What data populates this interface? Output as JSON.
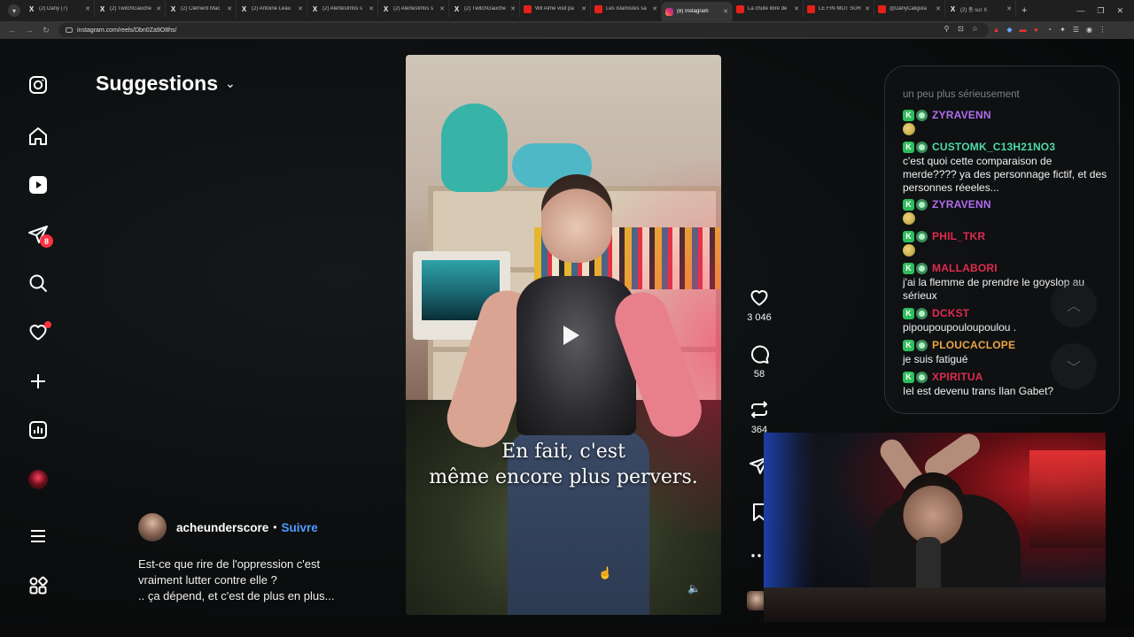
{
  "browser": {
    "tabs": [
      {
        "title": "(2) Dany (7)",
        "icon": "x"
      },
      {
        "title": "(2) TwitchGauche",
        "icon": "x"
      },
      {
        "title": "(2) Clément Mac",
        "icon": "x"
      },
      {
        "title": "(2) Antoine Léau",
        "icon": "x"
      },
      {
        "title": "(2) AlertesInfos s",
        "icon": "x"
      },
      {
        "title": "(2) AlertesInfos s",
        "icon": "x"
      },
      {
        "title": "(2) TwitchGauche",
        "icon": "x"
      },
      {
        "title": "Wil Aime visit pa",
        "icon": "youtube"
      },
      {
        "title": "Les islamistes sa",
        "icon": "youtube"
      },
      {
        "title": "(8) Instagram",
        "icon": "instagram",
        "active": true
      },
      {
        "title": "La chute libre de",
        "icon": "youtube"
      },
      {
        "title": "LE FIN MOT SUR",
        "icon": "youtube"
      },
      {
        "title": "@DanyCaligula",
        "icon": "youtube"
      },
      {
        "title": "(2) 총 sur X",
        "icon": "x"
      }
    ],
    "url": "instagram.com/reels/Dbn0Za9O8hs/"
  },
  "instagram": {
    "heading": "Suggestions",
    "notifications_badge": "8",
    "post": {
      "username": "acheunderscore",
      "separator": "•",
      "follow_label": "Suivre",
      "caption_line1": "Est-ce que rire de l'oppression c'est",
      "caption_line2": "vraiment lutter contre elle ?",
      "caption_line3": ".. ça dépend, et c'est de plus en plus..."
    },
    "video": {
      "subtitle_line1": "En fait, c'est",
      "subtitle_line2": "même encore plus pervers."
    },
    "actions": {
      "likes": "3 046",
      "comments": "58",
      "reposts": "364"
    }
  },
  "chat": {
    "faded_line": "un peu plus sérieusement",
    "messages": [
      {
        "user": "ZYRAVENN",
        "color": "#b26df0",
        "text": "",
        "emote": true
      },
      {
        "user": "CUSTOMK_C13H21NO3",
        "color": "#4fdba8",
        "text": "c'est quoi cette comparaison de merde???? ya des personnage fictif, et des personnes réeeles..."
      },
      {
        "user": "ZYRAVENN",
        "color": "#b26df0",
        "text": "",
        "emote": true
      },
      {
        "user": "PHIL_TKR",
        "color": "#e02b50",
        "text": "",
        "emote": true
      },
      {
        "user": "MALLABORI",
        "color": "#e02b50",
        "text": "j'ai la flemme de prendre le goyslop au sérieux"
      },
      {
        "user": "DCKST",
        "color": "#e02b50",
        "text": "pipoupoupouloupoulou ."
      },
      {
        "user": "PLOUCACLOPE",
        "color": "#e9a545",
        "text": "je suis fatigué"
      },
      {
        "user": "XPIRITUA",
        "color": "#e02b50",
        "text": "Iel est devenu trans Ilan Gabet?"
      }
    ]
  }
}
